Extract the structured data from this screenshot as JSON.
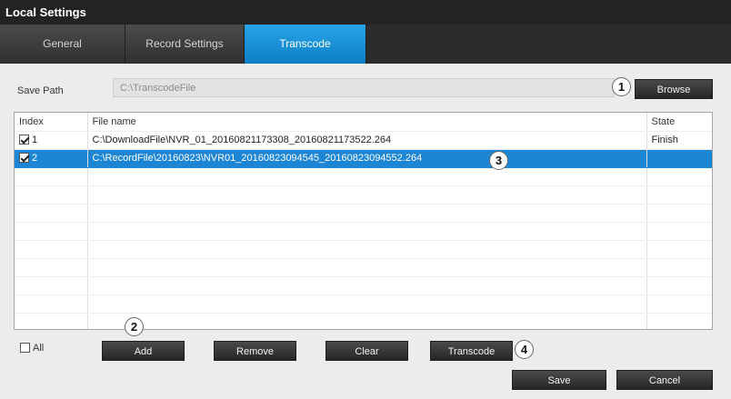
{
  "window": {
    "title": "Local Settings"
  },
  "tabs": [
    {
      "label": "General"
    },
    {
      "label": "Record Settings"
    },
    {
      "label": "Transcode"
    }
  ],
  "save_path": {
    "label": "Save Path",
    "value": "C:\\TranscodeFile",
    "browse_label": "Browse"
  },
  "file_table": {
    "headers": [
      "Index",
      "File name",
      "State"
    ],
    "rows": [
      {
        "index": "1",
        "file": "C:\\DownloadFile\\NVR_01_20160821173308_20160821173522.264",
        "state": "Finish",
        "checked": true
      },
      {
        "index": "2",
        "file": "C:\\RecordFile\\20160823\\NVR01_20160823094545_20160823094552.264",
        "state": "",
        "checked": true
      }
    ]
  },
  "footer": {
    "all_label": "All",
    "add_label": "Add",
    "remove_label": "Remove",
    "clear_label": "Clear",
    "transcode_label": "Transcode",
    "save_label": "Save",
    "cancel_label": "Cancel"
  },
  "callouts": [
    "1",
    "2",
    "3",
    "4"
  ],
  "colors": {
    "active_tab": "#1a94dc",
    "selected_row": "#1d86d4",
    "title_bar": "#232323"
  }
}
